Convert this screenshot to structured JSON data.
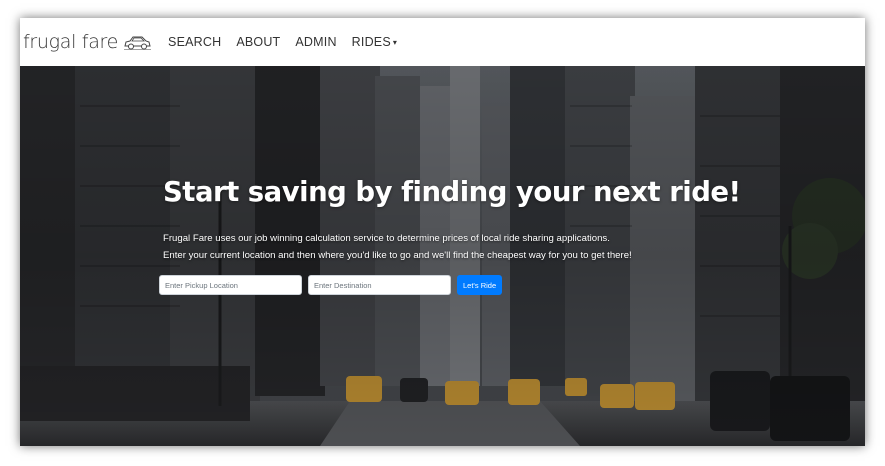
{
  "nav": {
    "brand": "frugal fare",
    "brand_icon": "car-icon",
    "links": {
      "search": "SEARCH",
      "about": "ABOUT",
      "admin": "ADMIN",
      "rides": "RIDES",
      "rides_caret": "▾"
    }
  },
  "hero": {
    "title": "Start saving by finding your next ride!",
    "line1": "Frugal Fare uses our job winning calculation service to determine prices of local ride sharing applications.",
    "line2": "Enter your current location and then where you'd like to go and we'll find the cheapest way for you to get there!",
    "background": "city-street-taxis-photo"
  },
  "form": {
    "pickup_placeholder": "Enter Pickup Location",
    "destination_placeholder": "Enter Destination",
    "submit_label": "Let's Ride"
  },
  "colors": {
    "accent": "#007bff",
    "navbar_bg": "#ffffff",
    "taxi": "#d8a33a"
  }
}
